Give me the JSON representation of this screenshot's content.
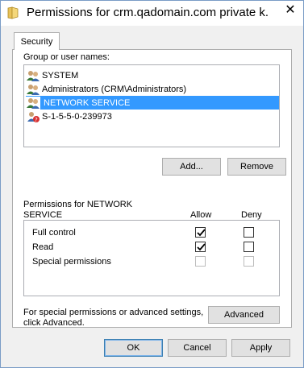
{
  "window": {
    "title": "Permissions for crm.qadomain.com private k...",
    "close_glyph": "✕"
  },
  "tabs": [
    {
      "label": "Security",
      "active": true
    }
  ],
  "group_list": {
    "label": "Group or user names:",
    "items": [
      {
        "name": "SYSTEM",
        "icon": "users-group-icon",
        "selected": false
      },
      {
        "name": "Administrators (CRM\\Administrators)",
        "icon": "users-group-icon",
        "selected": false
      },
      {
        "name": "NETWORK SERVICE",
        "icon": "users-group-icon",
        "selected": true
      },
      {
        "name": "S-1-5-5-0-239973",
        "icon": "unknown-user-icon",
        "selected": false
      }
    ]
  },
  "buttons": {
    "add": "Add...",
    "remove": "Remove",
    "advanced": "Advanced",
    "ok": "OK",
    "cancel": "Cancel",
    "apply": "Apply"
  },
  "permissions": {
    "header_line1": "Permissions for NETWORK",
    "header_line2": "SERVICE",
    "allow_label": "Allow",
    "deny_label": "Deny",
    "rows": [
      {
        "name": "Full control",
        "allow": true,
        "deny": false,
        "enabled": true
      },
      {
        "name": "Read",
        "allow": true,
        "deny": false,
        "enabled": true
      },
      {
        "name": "Special permissions",
        "allow": false,
        "deny": false,
        "enabled": false
      }
    ]
  },
  "advanced_note": {
    "line1": "For special permissions or advanced settings,",
    "line2": "click Advanced."
  },
  "colors": {
    "selection": "#3399ff",
    "button_face": "#e1e1e1",
    "dialog_bg": "#f0f0f0",
    "border": "#adadad"
  }
}
